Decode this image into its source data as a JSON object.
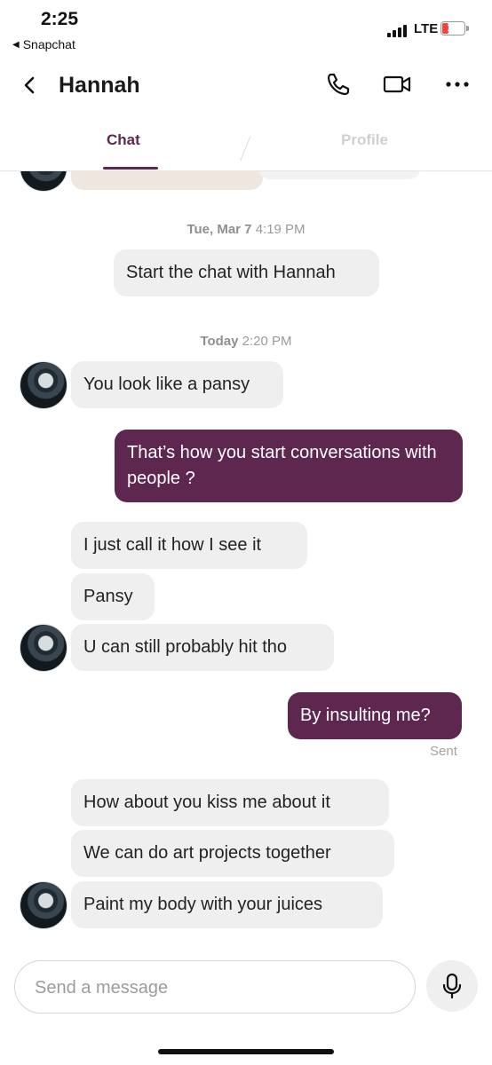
{
  "status_bar": {
    "time": "2:25",
    "back_app": "Snapchat",
    "network": "LTE",
    "battery": "10"
  },
  "header": {
    "title": "Hannah",
    "icons": [
      "back-chevron-icon",
      "phone-icon",
      "video-camera-icon",
      "more-icon"
    ]
  },
  "tabs": [
    {
      "label": "Chat",
      "active": true
    },
    {
      "label": "Profile",
      "active": false
    }
  ],
  "messages": {
    "ts1": {
      "day": "Tue, Mar 7",
      "time": "4:19 PM"
    },
    "system": "Start the chat with Hannah",
    "ts2": {
      "day": "Today",
      "time": "2:20 PM"
    },
    "m1": "You look like a pansy",
    "m2": "That’s how you start conversations with people ?",
    "m3": "I just call it how I see it",
    "m4": "Pansy",
    "m5": "U can still probably hit tho",
    "m6": "By insulting me?",
    "sent": "Sent",
    "m7": "How about you kiss me about it",
    "m8": "We can do art projects together",
    "m9": "Paint my body with your juices"
  },
  "composer": {
    "placeholder": "Send a message",
    "value": ""
  },
  "colors": {
    "accent": "#5e2750",
    "incoming": "#efefef",
    "timestamp": "#9a9a9a"
  }
}
